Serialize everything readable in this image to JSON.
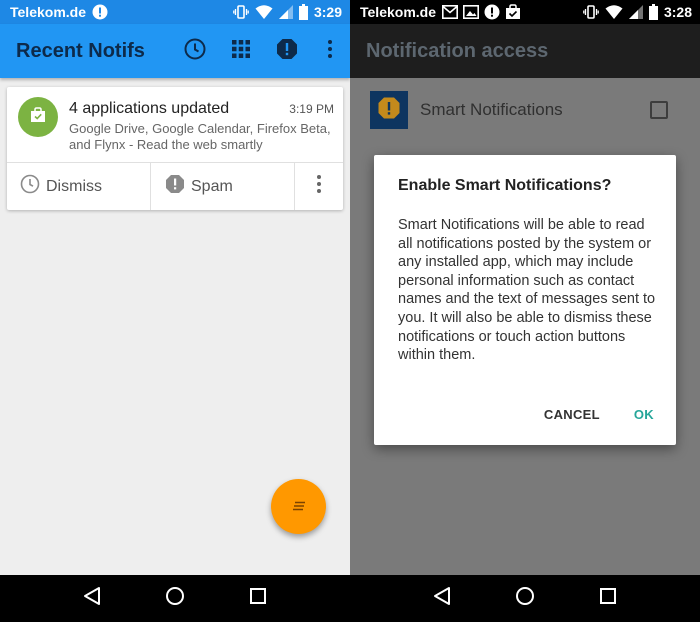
{
  "left_screen": {
    "status_bar": {
      "carrier": "Telekom.de",
      "time": "3:29"
    },
    "app_bar": {
      "title": "Recent Notifs"
    },
    "notification_card": {
      "title": "4 applications updated",
      "time": "3:19 PM",
      "body": "Google Drive, Google Calendar, Firefox Beta, and Flynx - Read the web smartly",
      "actions": {
        "dismiss": "Dismiss",
        "spam": "Spam"
      }
    }
  },
  "right_screen": {
    "status_bar": {
      "carrier": "Telekom.de",
      "time": "3:28"
    },
    "app_bar": {
      "title": "Notification access"
    },
    "setting_item": {
      "label": "Smart Notifications",
      "checked": false
    },
    "dialog": {
      "title": "Enable Smart Notifications?",
      "message": "Smart Notifications will be able to read all notifications posted by the system or any installed app, which may include personal information such as contact names and the text of messages sent to you. It will also be able to dismiss these notifications or touch action buttons within them.",
      "cancel_label": "CANCEL",
      "ok_label": "OK"
    }
  },
  "colors": {
    "left_app_bar": "#2196f3",
    "fab": "#ff9800",
    "avatar": "#7cb342",
    "dialog_ok": "#26a69a",
    "dimmed_background": "#7a7a7a"
  },
  "icons": {
    "status": [
      "alert-icon",
      "vibrate-icon",
      "wifi-icon",
      "signal-icon",
      "battery-icon",
      "gmail-icon",
      "image-icon",
      "calendar-check-icon"
    ],
    "app_bar": [
      "history-clock-icon",
      "grid-apps-icon",
      "spam-alert-icon",
      "overflow-menu-icon"
    ],
    "navigation": [
      "back-icon",
      "home-icon",
      "recents-icon"
    ]
  }
}
